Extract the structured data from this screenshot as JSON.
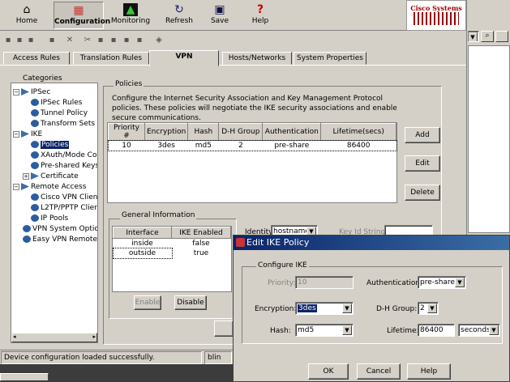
{
  "toolbar": {
    "home": "Home",
    "configuration": "Configuration",
    "monitoring": "Monitoring",
    "refresh": "Refresh",
    "save": "Save",
    "help": "Help",
    "brand": "Cisco Systems"
  },
  "tabs": [
    "Access Rules",
    "Translation Rules",
    "VPN",
    "Hosts/Networks",
    "System Properties"
  ],
  "categories": {
    "label": "Categories",
    "items": [
      "IPSec",
      "IPSec Rules",
      "Tunnel Policy",
      "Transform Sets",
      "IKE",
      "Policies",
      "XAuth/Mode Cor",
      "Pre-shared Keys",
      "Certificate",
      "Remote Access",
      "Cisco VPN Clien",
      "L2TP/PPTP Clier",
      "IP Pools",
      "VPN System Option",
      "Easy VPN Remote"
    ]
  },
  "policies": {
    "label": "Policies",
    "description": "Configure the Internet Security Association and Key Management Protocol policies. These policies will negotiate the IKE security associations and enable secure communications.",
    "columns": [
      "Priority #",
      "Encryption",
      "Hash",
      "D-H Group",
      "Authentication",
      "Lifetime(secs)"
    ],
    "rows": [
      [
        "10",
        "3des",
        "md5",
        "2",
        "pre-share",
        "86400"
      ]
    ],
    "add": "Add",
    "edit": "Edit",
    "delete": "Delete"
  },
  "general": {
    "label": "General Information",
    "columns": [
      "Interface",
      "IKE Enabled"
    ],
    "rows": [
      [
        "inside",
        "false"
      ],
      [
        "outside",
        "true"
      ]
    ],
    "enable": "Enable",
    "disable": "Disable",
    "identity_label": "Identity:",
    "identity_value": "hostname",
    "keyid_label": "Key Id String:"
  },
  "status": {
    "message": "Device configuration loaded successfully.",
    "user": "blin"
  },
  "dialog": {
    "title": "Edit IKE Policy",
    "group": "Configure IKE",
    "priority_label": "Priority:",
    "priority_value": "10",
    "auth_label": "Authentication:",
    "auth_value": "pre-share",
    "enc_label": "Encryption:",
    "enc_value": "3des",
    "dh_label": "D-H Group:",
    "dh_value": "2",
    "hash_label": "Hash:",
    "hash_value": "md5",
    "life_label": "Lifetime:",
    "life_value": "86400",
    "life_unit": "seconds",
    "ok": "OK",
    "cancel": "Cancel",
    "help": "Help"
  }
}
